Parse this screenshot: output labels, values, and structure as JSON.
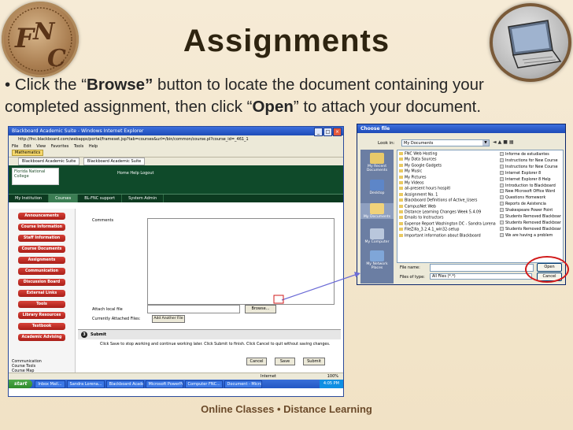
{
  "slide": {
    "title": "Assignments",
    "body": {
      "bullet": "•",
      "part1": "Click the “",
      "browse_word": "Browse”",
      "part2": " button to locate the document containing your completed assignment, then click “",
      "open_word": "Open",
      "part3": "” to attach your document."
    },
    "footer": "Online Classes •  Distance Learning",
    "seal_letters": "FNC",
    "colors": {
      "background": "#f3e6cc",
      "title": "#2e2410",
      "highlight": "#d11b1b",
      "footer": "#6b4a2a"
    },
    "icons": {
      "seal": "college-seal-icon",
      "laptop": "laptop-icon"
    }
  },
  "browser": {
    "window_title": "Blackboard Academic Suite - Windows Internet Explorer",
    "address": "http://fnc.blackboard.com/webapps/portal/frameset.jsp?tab=courses&url=/bin/common/course.pl?course_id=_461_1",
    "menu": [
      "File",
      "Edit",
      "View",
      "Favorites",
      "Tools",
      "Help"
    ],
    "links_label": "Mathematics",
    "tabs": [
      "Blackboard Academic Suite",
      "Blackboard Academic Suite"
    ],
    "logo_text": "Florida National College",
    "top_links": [
      "Home",
      "Help",
      "Logout"
    ],
    "nav_tabs": [
      "My Institution",
      "Courses",
      "BL-FNC support",
      "System Admin"
    ],
    "sidebar_buttons": [
      "Announcements",
      "Course Information",
      "Staff Information",
      "Course Documents",
      "Assignments",
      "Communication",
      "Discussion Board",
      "External Links",
      "Tools",
      "Library Resources",
      "Textbook",
      "Academic Advising"
    ],
    "tree": [
      "Communication",
      "Course Tools",
      "Course Map"
    ],
    "form": {
      "comments_label": "Comments",
      "attach_label": "Attach local file",
      "browse_button": "Browse...",
      "current_label": "Currently Attached Files:",
      "add_other_button": "Add Another File",
      "submit_heading": "Submit",
      "submit_number": "3",
      "submit_note": "Click Save to stop working and continue working later. Click Submit to finish. Click Cancel to quit without saving changes.",
      "cancel_button": "Cancel",
      "save_button": "Save",
      "submit_button": "Submit"
    },
    "status": {
      "zone": "Internet",
      "zoom": "100%"
    },
    "taskbar": {
      "start": "start",
      "tasks": [
        "Inbox Mail...",
        "Sandra Lorena...",
        "Blackboard Acade...",
        "Microsoft PowerPo...",
        "Computer FNC...",
        "Document - Micro..."
      ],
      "clock": "4:05 PM"
    }
  },
  "dialog": {
    "title": "Choose file",
    "look_in_label": "Look in:",
    "look_in_value": "My Documents",
    "places": [
      "My Recent Documents",
      "Desktop",
      "My Documents",
      "My Computer",
      "My Network Places"
    ],
    "files_col1": [
      "FNC Web Hosting",
      "My Data Sources",
      "My Google Gadgets",
      "My Music",
      "My Pictures",
      "My Videos",
      "all-present hours hospitl",
      "Assignment No. 1",
      "Blackboard Definitions of Active_Users",
      "CampusNet Web",
      "Distance Learning Changes Week 5.4.09",
      "Emails to Instructors",
      "Expense Report Washington DC - Sandra Lorena",
      "FileZilla_3.2.4.1_win32-setup",
      "Important information about Blackboard"
    ],
    "files_col2": [
      "Informe de estudiantes",
      "Instructions for New Course",
      "Instructions for New Course",
      "Internet Explorer 8",
      "Internet Explorer 8 Help",
      "Introduction to Blackboard",
      "New Microsoft Office Word",
      "Questions Homework",
      "Reports de Asistencia",
      "Shakespeare Power Point",
      "Students Removed Blackboard",
      "Students Removed Blackboard",
      "Students Removed Blackboard",
      "We are having a problem"
    ],
    "file_name_label": "File name:",
    "file_type_label": "Files of type:",
    "file_type_value": "All Files (*.*)",
    "open_button": "Open",
    "cancel_button": "Cancel"
  }
}
